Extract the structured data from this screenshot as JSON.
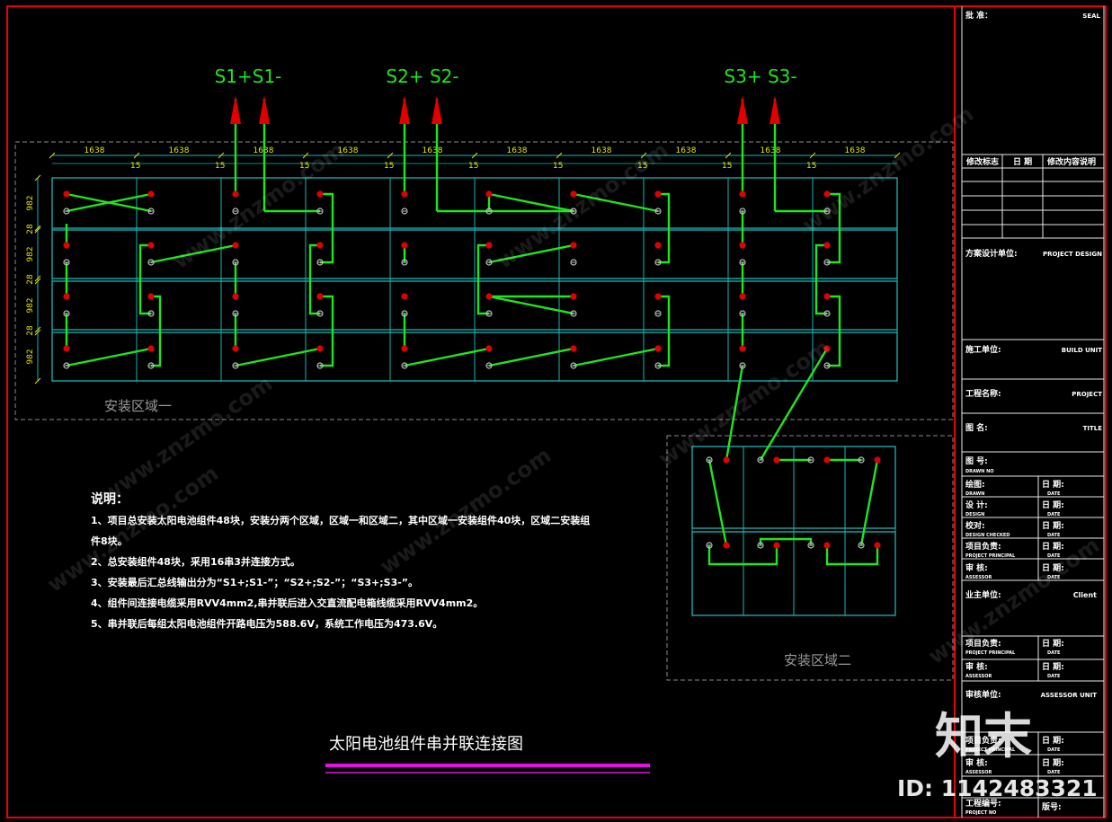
{
  "outputs": [
    {
      "label": "S1+S1-"
    },
    {
      "label": "S2+ S2-"
    },
    {
      "label": "S3+ S3-"
    }
  ],
  "region1": {
    "label": "安装区域一",
    "col_width": "1638",
    "gap": "15",
    "row_height": "982",
    "row_gap": "28"
  },
  "region2": {
    "label": "安装区域二"
  },
  "notes": {
    "title": "说明：",
    "lines": [
      "1、项目总安装太阳电池组件48块，安装分两个区域，区域一和区域二，其中区域一安装组件40块，区域二安装组",
      "件8块。",
      "2、总安装组件48块，采用16串3并连接方式。",
      "3、安装最后汇总线输出分为“S1+;S1-”；“S2+;S2-”；“S3+;S3-”。",
      "4、组件间连接电缆采用RVV4mm2,串并联后进入交直流配电箱线缆采用RVV4mm2。",
      "5、串并联后每组太阳电池组件开路电压为588.6V，系统工作电压为473.6V。"
    ]
  },
  "drawing_title": "太阳电池组件串并联连接图",
  "title_block": {
    "review_label": "批 准：",
    "review_value": "SEAL",
    "rev_headers": [
      "修改标志",
      "日 期",
      "修改内容说明"
    ],
    "design_unit_label": "方案设计单位:",
    "design_unit_value": "PROJECT DESIGN",
    "build_unit_label": "施工单位:",
    "build_unit_value": "BUILD UNIT",
    "project_label": "工程名称:",
    "project_value": "PROJECT",
    "drawing_name_label": "图 名:",
    "drawing_name_value": "TITLE",
    "drawing_no_label": "图 号:",
    "drawing_no_en": "DRAWN NO",
    "rows": [
      {
        "left": "绘图:",
        "left_en": "DRAWN",
        "right": "日 期:",
        "right_en": "DATE"
      },
      {
        "left": "设 计:",
        "left_en": "DESIGN",
        "right": "日 期:",
        "right_en": "DATE"
      },
      {
        "left": "校对:",
        "left_en": "DESIGN CHECKED",
        "right": "日 期:",
        "right_en": "DATE"
      },
      {
        "left": "项目负责:",
        "left_en": "PROJECT PRINCIPAL",
        "right": "日 期:",
        "right_en": "DATE"
      },
      {
        "left": "审 核:",
        "left_en": "ASSESSOR",
        "right": "日 期:",
        "right_en": "DATE"
      }
    ],
    "client_label": "业主单位:",
    "client_value": "Client",
    "rows2": [
      {
        "left": "项目负责:",
        "left_en": "PROJECT PRINCIPAL",
        "right": "日 期:",
        "right_en": "DATE"
      },
      {
        "left": "审 核:",
        "left_en": "ASSESSOR",
        "right": "日 期:",
        "right_en": "DATE"
      }
    ],
    "assessor_unit_label": "审核单位:",
    "assessor_unit_value": "ASSESSOR UNIT",
    "rows3": [
      {
        "left": "项目负责:",
        "left_en": "PROJECT PRINCIPAL",
        "right": "日 期:",
        "right_en": "DATE"
      },
      {
        "left": "审 核:",
        "left_en": "ASSESSOR",
        "right": "日 期:",
        "right_en": "DATE"
      }
    ],
    "project_no_label": "工程编号:",
    "project_no_en": "PROJECT NO",
    "sheet_no_label": "版号:"
  },
  "watermark": {
    "logo": "知末",
    "id_text": "ID: 1142483321",
    "tile_text": "www.znzmo.com"
  },
  "colors": {
    "frame": "#e8000f",
    "grid": "#19b5b5",
    "wire": "#1ee61e",
    "terminal_pos": "#e00000",
    "terminal_neg": "#bfbfbf",
    "dim": "#e6e600",
    "magenta": "#e60fe6"
  }
}
